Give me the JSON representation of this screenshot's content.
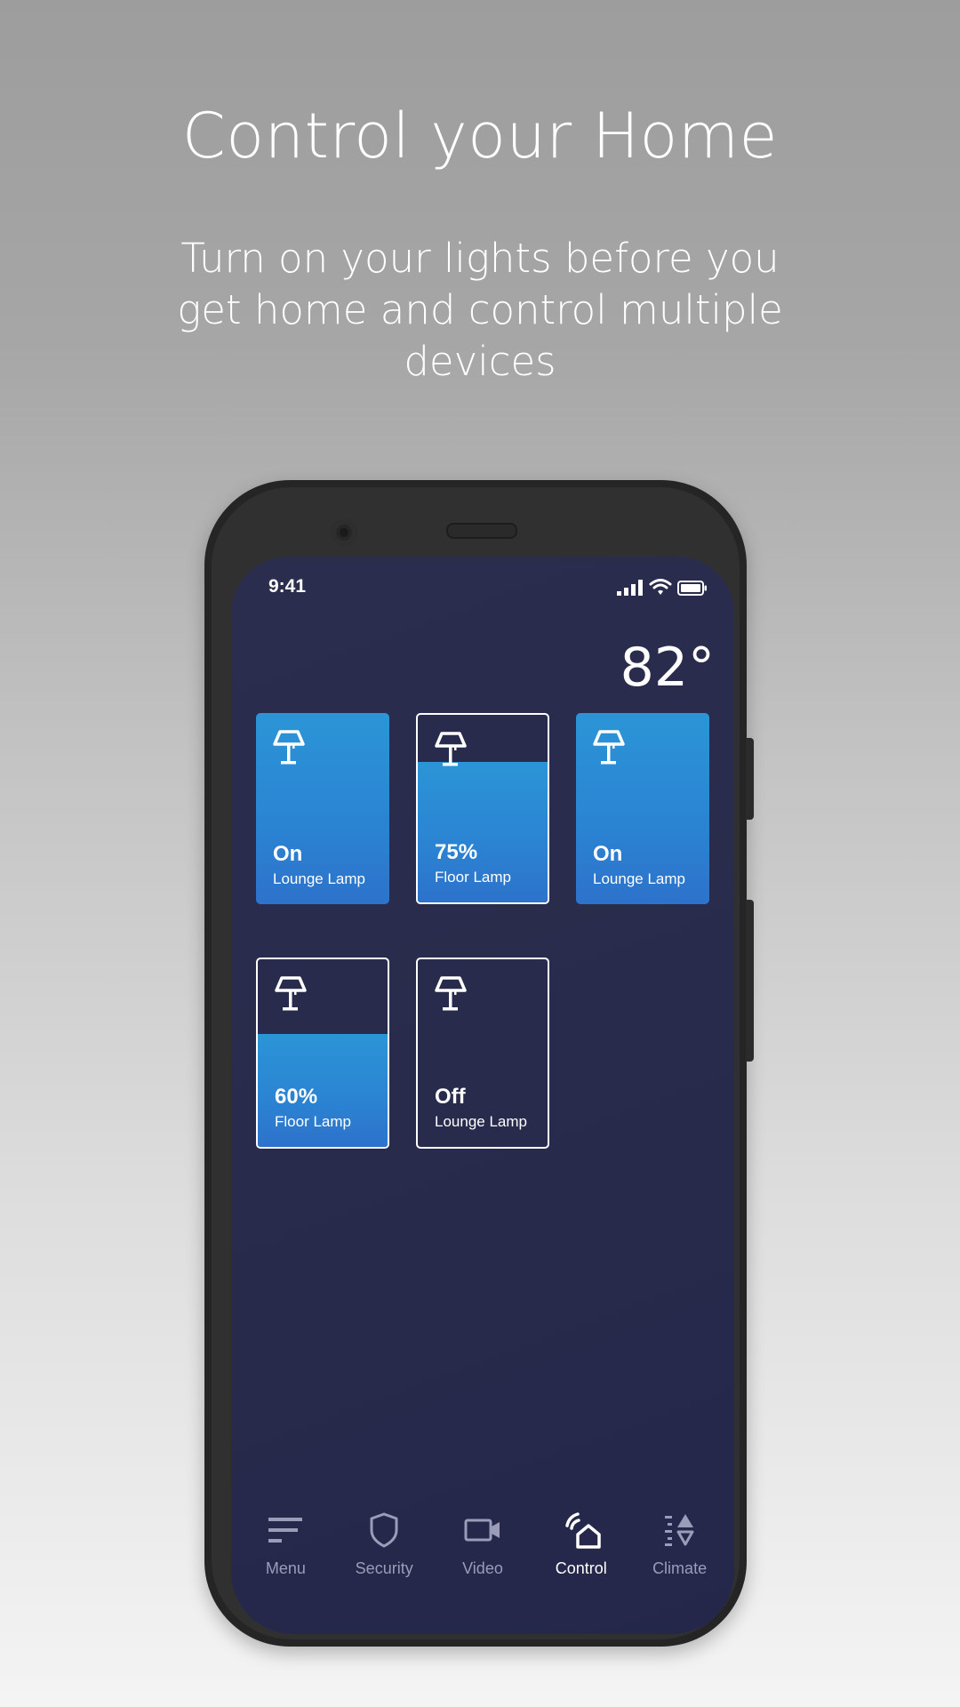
{
  "headline": "Control your Home",
  "subhead": "Turn on your lights before you get home and control multiple devices",
  "status_bar": {
    "time": "9:41",
    "icons": [
      "signal-icon",
      "wifi-icon",
      "battery-icon"
    ]
  },
  "temperature": "82°",
  "colors": {
    "accent": "#2b8fd5",
    "screen_bg": "#2a2c4c",
    "tab_inactive": "#9a9cb8",
    "tab_active": "#ffffff"
  },
  "tiles": [
    {
      "state": "On",
      "name": "Lounge Lamp",
      "level": 1.0,
      "icon": "lamp-icon"
    },
    {
      "state": "75%",
      "name": "Floor Lamp",
      "level": 0.75,
      "icon": "lamp-icon"
    },
    {
      "state": "On",
      "name": "Lounge Lamp",
      "level": 1.0,
      "icon": "lamp-icon"
    },
    {
      "state": "60%",
      "name": "Floor Lamp",
      "level": 0.6,
      "icon": "lamp-icon"
    },
    {
      "state": "Off",
      "name": "Lounge Lamp",
      "level": 0.0,
      "icon": "lamp-icon"
    }
  ],
  "tabs": [
    {
      "label": "Menu",
      "icon": "menu-icon",
      "active": false
    },
    {
      "label": "Security",
      "icon": "shield-icon",
      "active": false
    },
    {
      "label": "Video",
      "icon": "video-camera-icon",
      "active": false
    },
    {
      "label": "Control",
      "icon": "smart-home-icon",
      "active": true
    },
    {
      "label": "Climate",
      "icon": "climate-icon",
      "active": false
    }
  ]
}
